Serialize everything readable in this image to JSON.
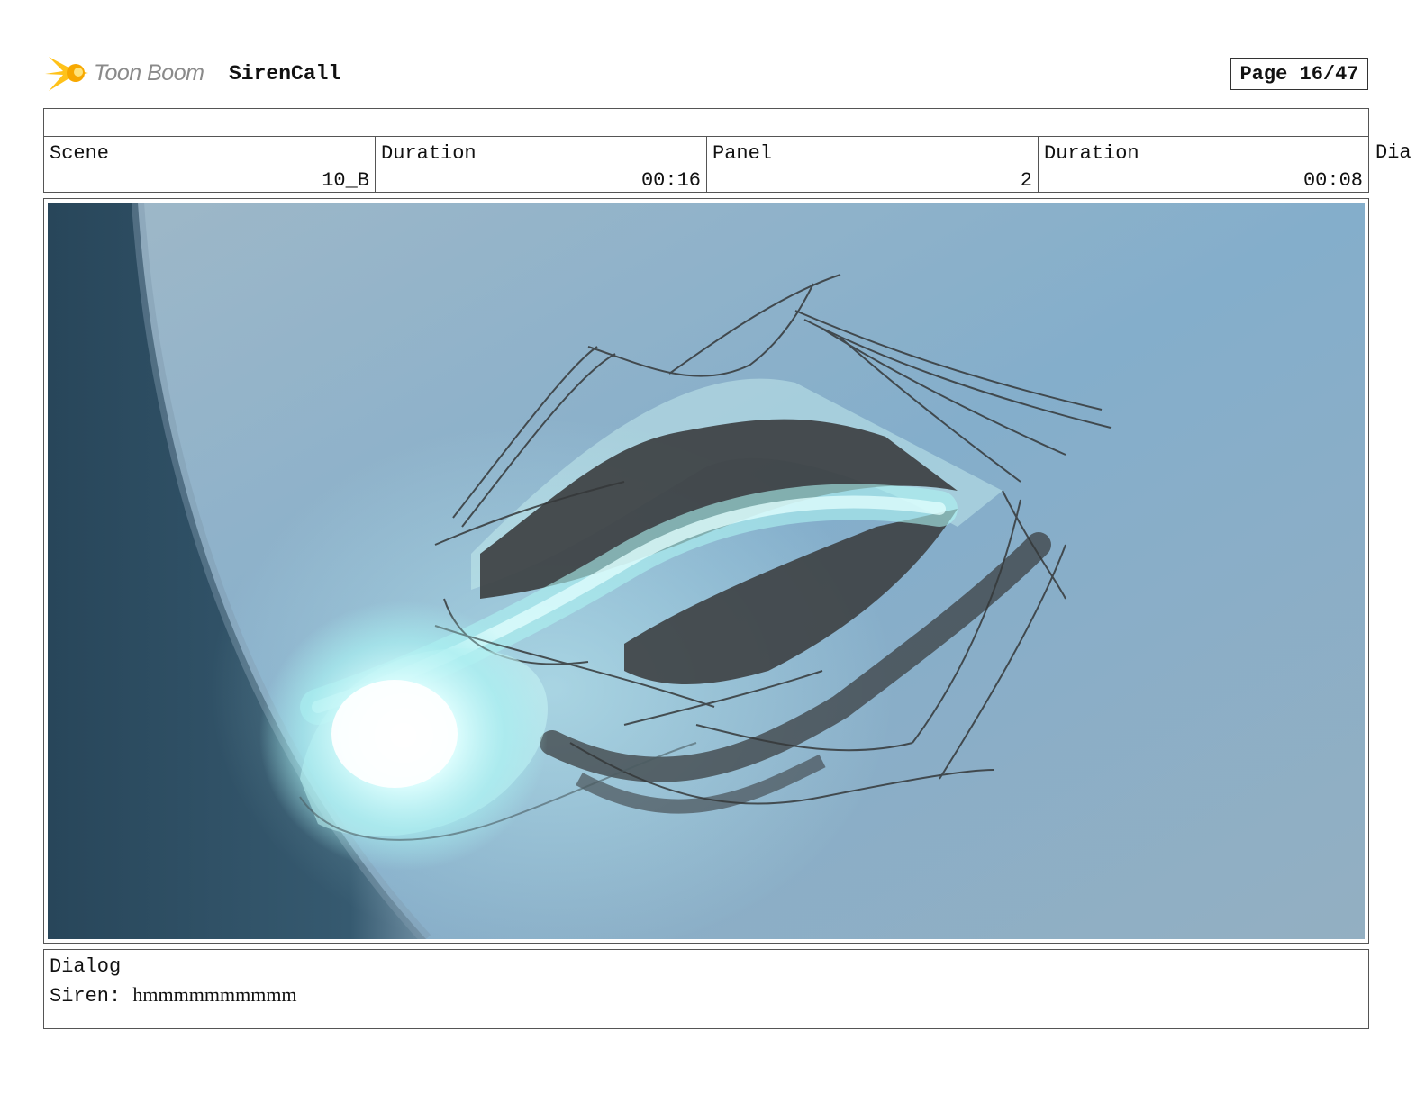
{
  "header": {
    "logo_text": "Toon Boom",
    "project_title": "SirenCall",
    "page_label": "Page 16/47"
  },
  "info": {
    "scene_label": "Scene",
    "scene_value": "10_B",
    "scene_duration_label": "Duration",
    "scene_duration_value": "00:16",
    "panel_label": "Panel",
    "panel_value": "2",
    "panel_duration_label": "Duration",
    "panel_duration_value": "00:08",
    "overflow_label": "Dia"
  },
  "dialog": {
    "title": "Dialog",
    "speaker": "Siren:",
    "text": "hmmmmmmmmmm"
  },
  "colors": {
    "sky": "#86aec8",
    "dark_edge": "#2d4a5e",
    "glow": "#c8fbfb",
    "shadow_strokes": "#404346"
  }
}
